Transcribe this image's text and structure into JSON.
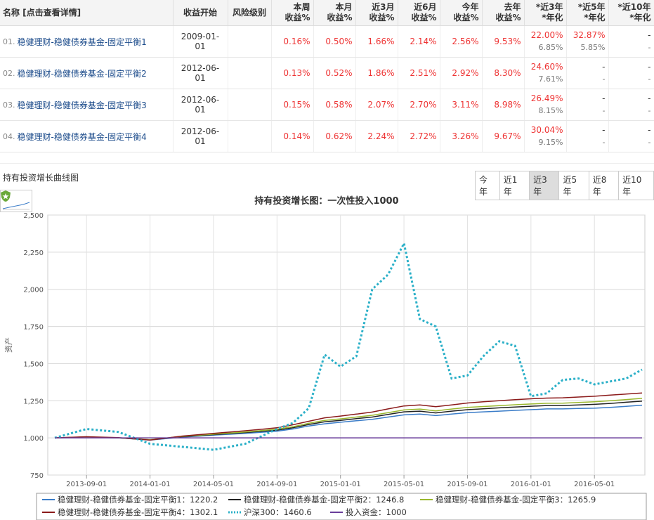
{
  "table": {
    "headers": {
      "name": "名称 [点击查看详情]",
      "start": "收益开始",
      "risk": "风险级别",
      "week1": "本周",
      "week2": "收益%",
      "month1": "本月",
      "month2": "收益%",
      "m3a": "近3月",
      "m3b": "收益%",
      "m6a": "近6月",
      "m6b": "收益%",
      "ya": "今年",
      "yb": "收益%",
      "lya": "去年",
      "lyb": "收益%",
      "y3a": "*近3年",
      "y3b": "*年化",
      "y5a": "*近5年",
      "y5b": "*年化",
      "y10a": "*近10年",
      "y10b": "*年化"
    },
    "rows": [
      {
        "idx": "01.",
        "name": "稳健理财-稳健债券基金-固定平衡1",
        "start": "2009-01-01",
        "week": "0.16%",
        "month": "0.50%",
        "m3": "1.66%",
        "m6": "2.14%",
        "ytd": "2.56%",
        "ly": "9.53%",
        "y3": "22.00%",
        "y3ann": "6.85%",
        "y5": "32.87%",
        "y5ann": "5.85%",
        "y10": "-",
        "y10ann": "-"
      },
      {
        "idx": "02.",
        "name": "稳健理财-稳健债券基金-固定平衡2",
        "start": "2012-06-01",
        "week": "0.13%",
        "month": "0.52%",
        "m3": "1.86%",
        "m6": "2.51%",
        "ytd": "2.92%",
        "ly": "8.30%",
        "y3": "24.60%",
        "y3ann": "7.61%",
        "y5": "-",
        "y5ann": "-",
        "y10": "-",
        "y10ann": "-"
      },
      {
        "idx": "03.",
        "name": "稳健理财-稳健债券基金-固定平衡3",
        "start": "2012-06-01",
        "week": "0.15%",
        "month": "0.58%",
        "m3": "2.07%",
        "m6": "2.70%",
        "ytd": "3.11%",
        "ly": "8.98%",
        "y3": "26.49%",
        "y3ann": "8.15%",
        "y5": "-",
        "y5ann": "-",
        "y10": "-",
        "y10ann": "-"
      },
      {
        "idx": "04.",
        "name": "稳健理财-稳健债券基金-固定平衡4",
        "start": "2012-06-01",
        "week": "0.14%",
        "month": "0.62%",
        "m3": "2.24%",
        "m6": "2.72%",
        "ytd": "3.26%",
        "ly": "9.67%",
        "y3": "30.04%",
        "y3ann": "9.15%",
        "y5": "-",
        "y5ann": "-",
        "y10": "-",
        "y10ann": "-"
      }
    ]
  },
  "section": {
    "title": "持有投资增长曲线图"
  },
  "ranges": [
    "今年",
    "近1年",
    "近3年",
    "近5年",
    "近8年",
    "近10年"
  ],
  "active_range": "近3年",
  "chart_data": {
    "type": "line",
    "title": "持有投资增长图：一次性投入1000",
    "ylabel": "资产",
    "ylim": [
      750,
      2500
    ],
    "yticks": [
      "750",
      "1,000",
      "1,250",
      "1,500",
      "1,750",
      "2,000",
      "2,250",
      "2,500"
    ],
    "xticks": [
      "2013-09-01",
      "2014-01-01",
      "2014-05-01",
      "2014-09-01",
      "2015-01-01",
      "2015-05-01",
      "2015-09-01",
      "2016-01-01",
      "2016-05-01"
    ],
    "x": [
      "2013-07",
      "2013-09",
      "2013-11",
      "2014-01",
      "2014-03",
      "2014-05",
      "2014-07",
      "2014-09",
      "2014-10",
      "2014-11",
      "2014-12",
      "2015-01",
      "2015-02",
      "2015-03",
      "2015-04",
      "2015-05",
      "2015-06",
      "2015-07",
      "2015-08",
      "2015-09",
      "2015-10",
      "2015-11",
      "2015-12",
      "2016-01",
      "2016-02",
      "2016-03",
      "2016-04",
      "2016-05",
      "2016-06",
      "2016-07",
      "2016-08"
    ],
    "grid": true,
    "legend_position": "bottom",
    "series": [
      {
        "name": "稳健理财-稳健债券基金-固定平衡1：1220.2",
        "color": "#3a7cc8",
        "style": "solid",
        "values": [
          1000,
          1005,
          1000,
          985,
          1005,
          1018,
          1030,
          1045,
          1060,
          1080,
          1095,
          1105,
          1115,
          1125,
          1140,
          1155,
          1160,
          1150,
          1160,
          1170,
          1175,
          1180,
          1185,
          1190,
          1195,
          1195,
          1198,
          1200,
          1205,
          1212,
          1220
        ]
      },
      {
        "name": "稳健理财-稳健债券基金-固定平衡2：1246.8",
        "color": "#222222",
        "style": "solid",
        "values": [
          1000,
          1006,
          1000,
          987,
          1008,
          1022,
          1036,
          1052,
          1068,
          1090,
          1108,
          1118,
          1130,
          1140,
          1158,
          1175,
          1180,
          1168,
          1180,
          1190,
          1196,
          1202,
          1208,
          1213,
          1218,
          1218,
          1222,
          1226,
          1232,
          1240,
          1247
        ]
      },
      {
        "name": "稳健理财-稳健债券基金-固定平衡3：1265.9",
        "color": "#9ab82e",
        "style": "solid",
        "values": [
          1000,
          1006,
          1000,
          988,
          1010,
          1025,
          1040,
          1058,
          1075,
          1098,
          1118,
          1128,
          1140,
          1152,
          1170,
          1188,
          1194,
          1182,
          1194,
          1205,
          1211,
          1217,
          1223,
          1228,
          1233,
          1234,
          1238,
          1243,
          1250,
          1258,
          1266
        ]
      },
      {
        "name": "稳健理财-稳健债券基金-固定平衡4：1302.1",
        "color": "#8b1a1a",
        "style": "solid",
        "values": [
          1000,
          1008,
          1002,
          985,
          1012,
          1030,
          1048,
          1068,
          1088,
          1112,
          1135,
          1147,
          1160,
          1174,
          1195,
          1215,
          1222,
          1210,
          1222,
          1235,
          1243,
          1250,
          1257,
          1263,
          1268,
          1270,
          1275,
          1280,
          1288,
          1295,
          1302
        ]
      },
      {
        "name": "沪深300：1460.6",
        "color": "#2bb0c8",
        "style": "dotted",
        "values": [
          1000,
          1060,
          1040,
          960,
          940,
          920,
          960,
          1060,
          1100,
          1200,
          1560,
          1480,
          1550,
          2000,
          2100,
          2310,
          1800,
          1750,
          1400,
          1420,
          1550,
          1650,
          1620,
          1280,
          1300,
          1390,
          1400,
          1360,
          1380,
          1400,
          1460
        ]
      },
      {
        "name": "投入资金：1000",
        "color": "#6a3d9a",
        "style": "solid",
        "values": [
          1000,
          1000,
          1000,
          1000,
          1000,
          1000,
          1000,
          1000,
          1000,
          1000,
          1000,
          1000,
          1000,
          1000,
          1000,
          1000,
          1000,
          1000,
          1000,
          1000,
          1000,
          1000,
          1000,
          1000,
          1000,
          1000,
          1000,
          1000,
          1000,
          1000,
          1000
        ]
      }
    ]
  }
}
